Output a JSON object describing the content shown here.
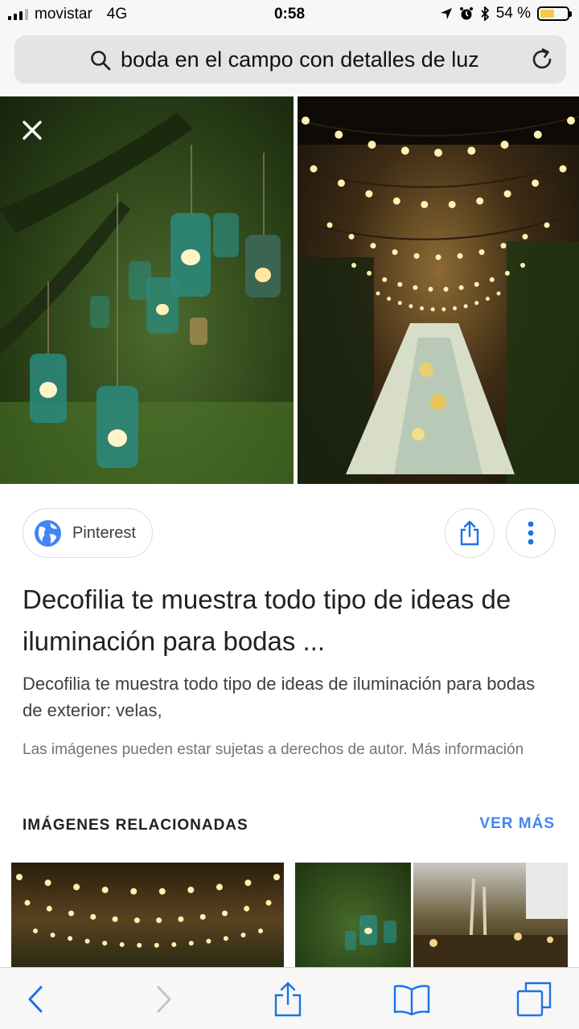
{
  "status_bar": {
    "carrier": "movistar",
    "network": "4G",
    "time": "0:58",
    "battery_percent": "54 %",
    "battery_level": 0.54
  },
  "address_bar": {
    "query": "boda en el campo con detalles de luz"
  },
  "result": {
    "source": "Pinterest",
    "title": "Decofilia te muestra todo tipo de ideas de iluminación para bodas ...",
    "description": "Decofilia te muestra todo tipo de ideas de iluminación para bodas de exterior: velas,",
    "copyright": "Las imágenes pueden estar sujetas a derechos de autor. Más información"
  },
  "related": {
    "heading": "IMÁGENES RELACIONADAS",
    "see_more": "VER MÁS"
  },
  "colors": {
    "accent": "#4285f4",
    "battery": "#f7c948",
    "toolbar_icon": "#1a73e8"
  },
  "icons": [
    "search-icon",
    "reload-icon",
    "close-icon",
    "globe-icon",
    "share-icon",
    "more-vert-icon",
    "back-icon",
    "forward-icon",
    "bookmarks-icon",
    "tabs-icon"
  ]
}
